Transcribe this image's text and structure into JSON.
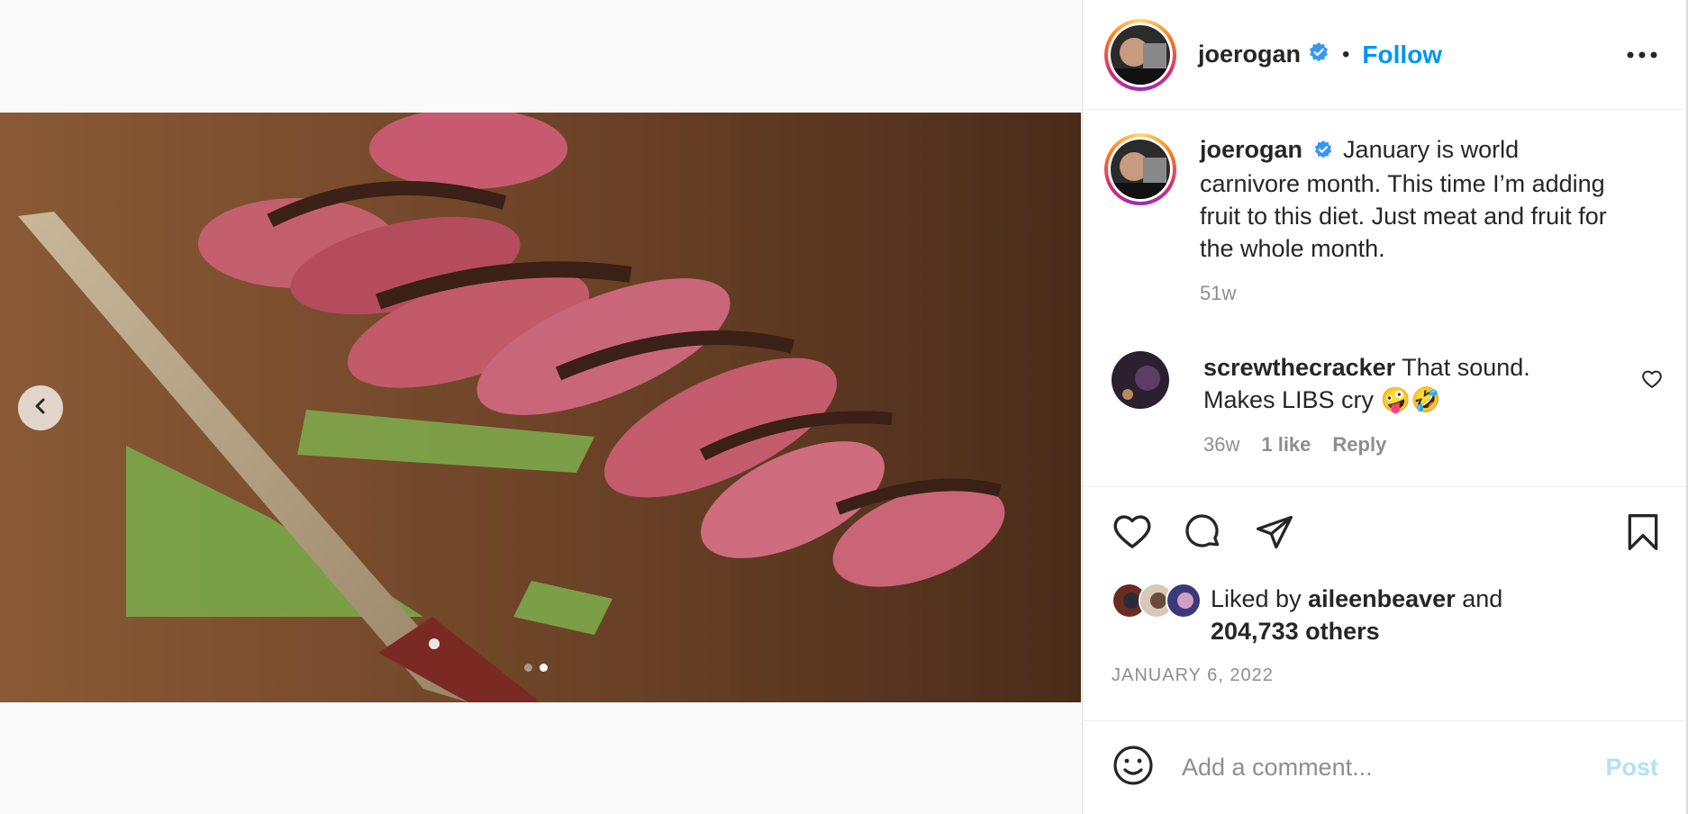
{
  "post": {
    "author": "joerogan",
    "follow_label": "Follow",
    "separator": "•"
  },
  "caption": {
    "username": "joerogan",
    "text": "January is world carnivore month. This time I’m adding fruit to this diet. Just meat and fruit for the whole month.",
    "age": "51w"
  },
  "comments": [
    {
      "username": "screwthecracker",
      "text": "That sound. Makes LIBS cry 🤪🤣",
      "age": "36w",
      "likes": "1 like",
      "reply_label": "Reply"
    }
  ],
  "likes": {
    "prefix": "Liked by",
    "user": "aileenbeaver",
    "conj": "and",
    "others": "204,733 others"
  },
  "date": "JANUARY 6, 2022",
  "composer": {
    "placeholder": "Add a comment...",
    "post_label": "Post"
  },
  "carousel": {
    "slides": 2,
    "active_slide": 2
  },
  "colors": {
    "accent": "#0095f6",
    "verified": "#3897f0",
    "muted": "#8e8e8e",
    "post_disabled": "#b2dffc"
  },
  "icons": [
    "chevron-left-icon",
    "verified-badge-icon",
    "more-horizontal-icon",
    "heart-icon",
    "comment-icon",
    "share-icon",
    "bookmark-icon",
    "emoji-icon"
  ]
}
